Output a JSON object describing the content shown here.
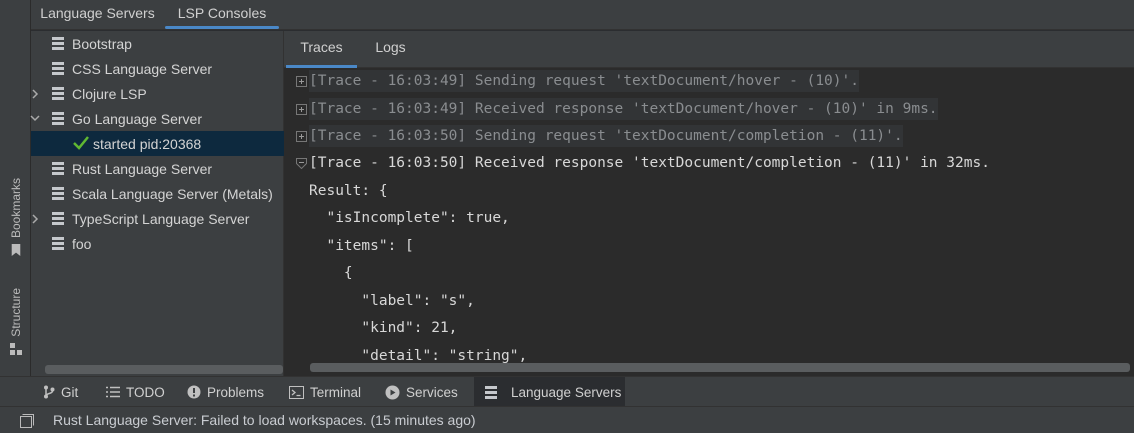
{
  "left_stripe": {
    "bookmarks_label": "Bookmarks",
    "structure_label": "Structure"
  },
  "top_tabs": [
    {
      "label": "Language Servers"
    },
    {
      "label": "LSP Consoles"
    }
  ],
  "servers": [
    {
      "label": "Bootstrap",
      "expanded": false
    },
    {
      "label": "CSS Language Server",
      "expanded": false
    },
    {
      "label": "Clojure LSP",
      "expanded": false
    },
    {
      "label": "Go Language Server",
      "expanded": true
    },
    {
      "label": "started pid:20368",
      "child": true,
      "selected": true,
      "status": "started"
    },
    {
      "label": "Rust Language Server",
      "expanded": false
    },
    {
      "label": "Scala Language Server (Metals)",
      "expanded": false
    },
    {
      "label": "TypeScript Language Server",
      "expanded": false
    },
    {
      "label": "foo",
      "expanded": false
    }
  ],
  "console": {
    "tabs": [
      {
        "label": "Traces"
      },
      {
        "label": "Logs"
      }
    ],
    "active_tab": "Traces",
    "lines": [
      {
        "text": "[Trace - 16:03:49] Sending request 'textDocument/hover - (10)'.",
        "kind": "dim",
        "fold": "plus"
      },
      {
        "text": "[Trace - 16:03:49] Received response 'textDocument/hover - (10)' in 9ms.",
        "kind": "dim",
        "fold": "plus"
      },
      {
        "text": "[Trace - 16:03:50] Sending request 'textDocument/completion - (11)'.",
        "kind": "dim",
        "fold": "plus"
      },
      {
        "text": "[Trace - 16:03:50] Received response 'textDocument/completion - (11)' in 32ms.",
        "kind": "bright",
        "fold": "minus"
      },
      {
        "text": "Result: {",
        "kind": "json"
      },
      {
        "text": "  \"isIncomplete\": true,",
        "kind": "json"
      },
      {
        "text": "  \"items\": [",
        "kind": "json"
      },
      {
        "text": "    {",
        "kind": "json"
      },
      {
        "text": "      \"label\": \"s\",",
        "kind": "json"
      },
      {
        "text": "      \"kind\": 21,",
        "kind": "json"
      },
      {
        "text": "      \"detail\": \"string\",",
        "kind": "json"
      }
    ]
  },
  "bottom_tools": [
    {
      "label": "Git",
      "icon": "git-branch-icon"
    },
    {
      "label": "TODO",
      "icon": "list-icon"
    },
    {
      "label": "Problems",
      "icon": "problems-icon"
    },
    {
      "label": "Terminal",
      "icon": "terminal-icon"
    },
    {
      "label": "Services",
      "icon": "services-icon"
    },
    {
      "label": "Language Servers",
      "icon": "server-icon",
      "active": true
    }
  ],
  "status": {
    "message": "Rust Language Server: Failed to load workspaces. (15 minutes ago)"
  },
  "colors": {
    "accent": "#4a88c7",
    "success": "#5fb832",
    "selection": "#0d293e"
  }
}
